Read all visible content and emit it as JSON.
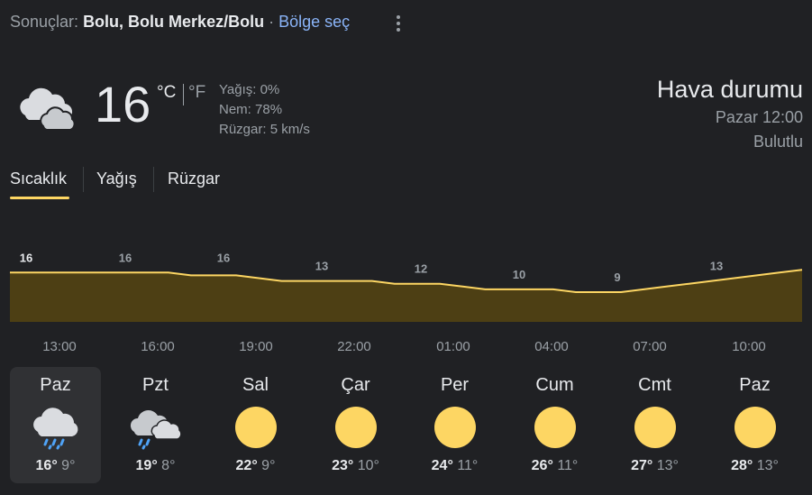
{
  "header": {
    "prefix": "Sonuçlar:",
    "location": "Bolu, Bolu Merkez/Bolu",
    "separator": "·",
    "region_link": "Bölge seç"
  },
  "current": {
    "icon": "cloudy-icon",
    "temperature": "16",
    "unit_c": "°C",
    "unit_f": "°F",
    "precipitation": "Yağış: 0%",
    "humidity": "Nem: 78%",
    "wind": "Rüzgar: 5 km/s"
  },
  "title": "Hava durumu",
  "datetime": "Pazar 12:00",
  "condition": "Bulutlu",
  "tabs": [
    {
      "label": "Sıcaklık",
      "active": true
    },
    {
      "label": "Yağış",
      "active": false
    },
    {
      "label": "Rüzgar",
      "active": false
    }
  ],
  "colors": {
    "accent": "#fdd663",
    "area_fill": "#4d3f14",
    "background": "#202124",
    "link": "#8ab4f8"
  },
  "chart_data": {
    "type": "area",
    "series": [
      {
        "values": [
          16,
          16,
          16,
          16,
          16,
          16,
          16,
          16,
          15,
          15,
          15,
          14,
          13,
          13,
          13,
          13,
          13,
          12,
          12,
          12,
          11,
          10,
          10,
          10,
          10,
          9,
          9,
          9,
          10,
          11,
          12,
          13,
          14,
          15,
          16,
          17
        ]
      }
    ],
    "value_labels": [
      "16",
      "16",
      "16",
      "13",
      "12",
      "10",
      "9",
      "13"
    ],
    "time_labels": [
      "13:00",
      "16:00",
      "19:00",
      "22:00",
      "01:00",
      "04:00",
      "07:00",
      "10:00"
    ]
  },
  "days": [
    {
      "name": "Paz",
      "icon": "rain-cloud-icon",
      "high": "16°",
      "low": "9°",
      "selected": true
    },
    {
      "name": "Pzt",
      "icon": "thunder-rain-icon",
      "high": "19°",
      "low": "8°",
      "selected": false
    },
    {
      "name": "Sal",
      "icon": "sun-icon",
      "high": "22°",
      "low": "9°",
      "selected": false
    },
    {
      "name": "Çar",
      "icon": "sun-icon",
      "high": "23°",
      "low": "10°",
      "selected": false
    },
    {
      "name": "Per",
      "icon": "sun-icon",
      "high": "24°",
      "low": "11°",
      "selected": false
    },
    {
      "name": "Cum",
      "icon": "sun-icon",
      "high": "26°",
      "low": "11°",
      "selected": false
    },
    {
      "name": "Cmt",
      "icon": "sun-icon",
      "high": "27°",
      "low": "13°",
      "selected": false
    },
    {
      "name": "Paz",
      "icon": "sun-icon",
      "high": "28°",
      "low": "13°",
      "selected": false
    }
  ]
}
